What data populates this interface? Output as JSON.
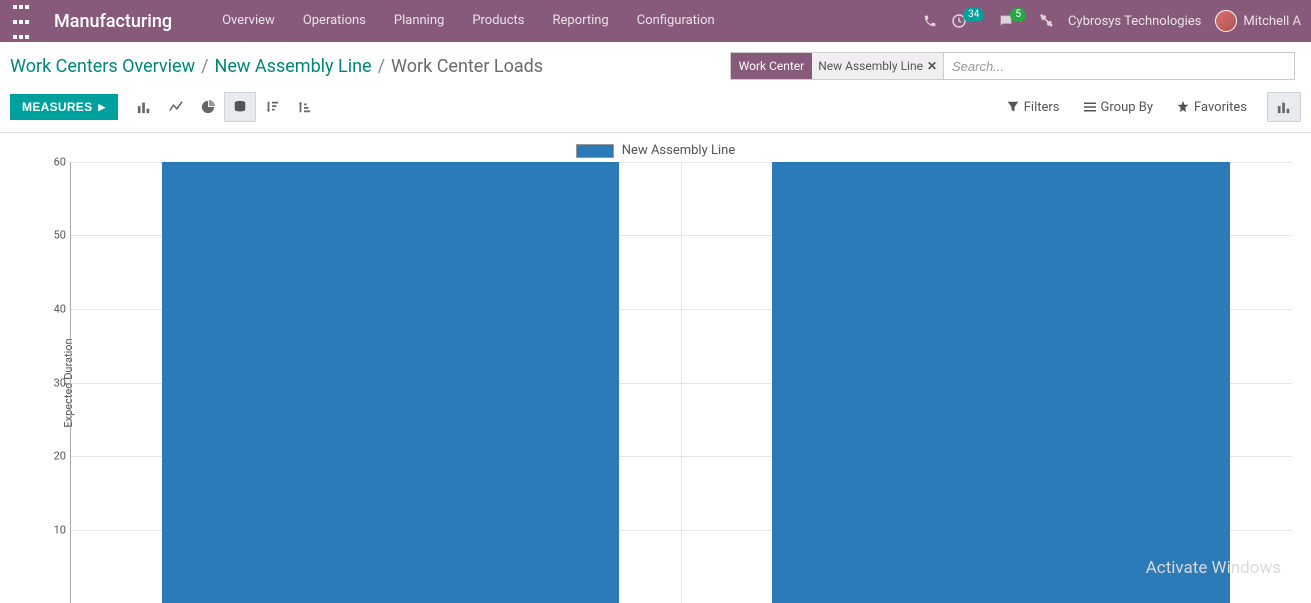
{
  "nav": {
    "app_title": "Manufacturing",
    "menu": [
      "Overview",
      "Operations",
      "Planning",
      "Products",
      "Reporting",
      "Configuration"
    ],
    "badge_timer": "34",
    "badge_msg": "5",
    "company": "Cybrosys Technologies",
    "user_name": "Mitchell A"
  },
  "breadcrumb": {
    "root": "Work Centers Overview",
    "mid": "New Assembly Line",
    "current": "Work Center Loads",
    "sep": "/"
  },
  "search": {
    "facet_label": "Work Center",
    "facet_value": "New Assembly Line",
    "placeholder": "Search..."
  },
  "cp": {
    "measures": "MEASURES",
    "filters": "Filters",
    "groupby": "Group By",
    "favorites": "Favorites"
  },
  "chart_legend": "New Assembly Line",
  "ylabel": "Expected Duration",
  "watermark": "Activate Windows",
  "chart_data": {
    "type": "bar",
    "categories": [
      "",
      ""
    ],
    "series": [
      {
        "name": "New Assembly Line",
        "values": [
          60,
          60
        ]
      }
    ],
    "title": "",
    "xlabel": "",
    "ylabel": "Expected Duration",
    "ylim": [
      0,
      60
    ],
    "yticks": [
      10,
      20,
      30,
      40,
      50,
      60
    ],
    "color": "#2b7bb9",
    "grid": true,
    "legend_position": "top"
  }
}
